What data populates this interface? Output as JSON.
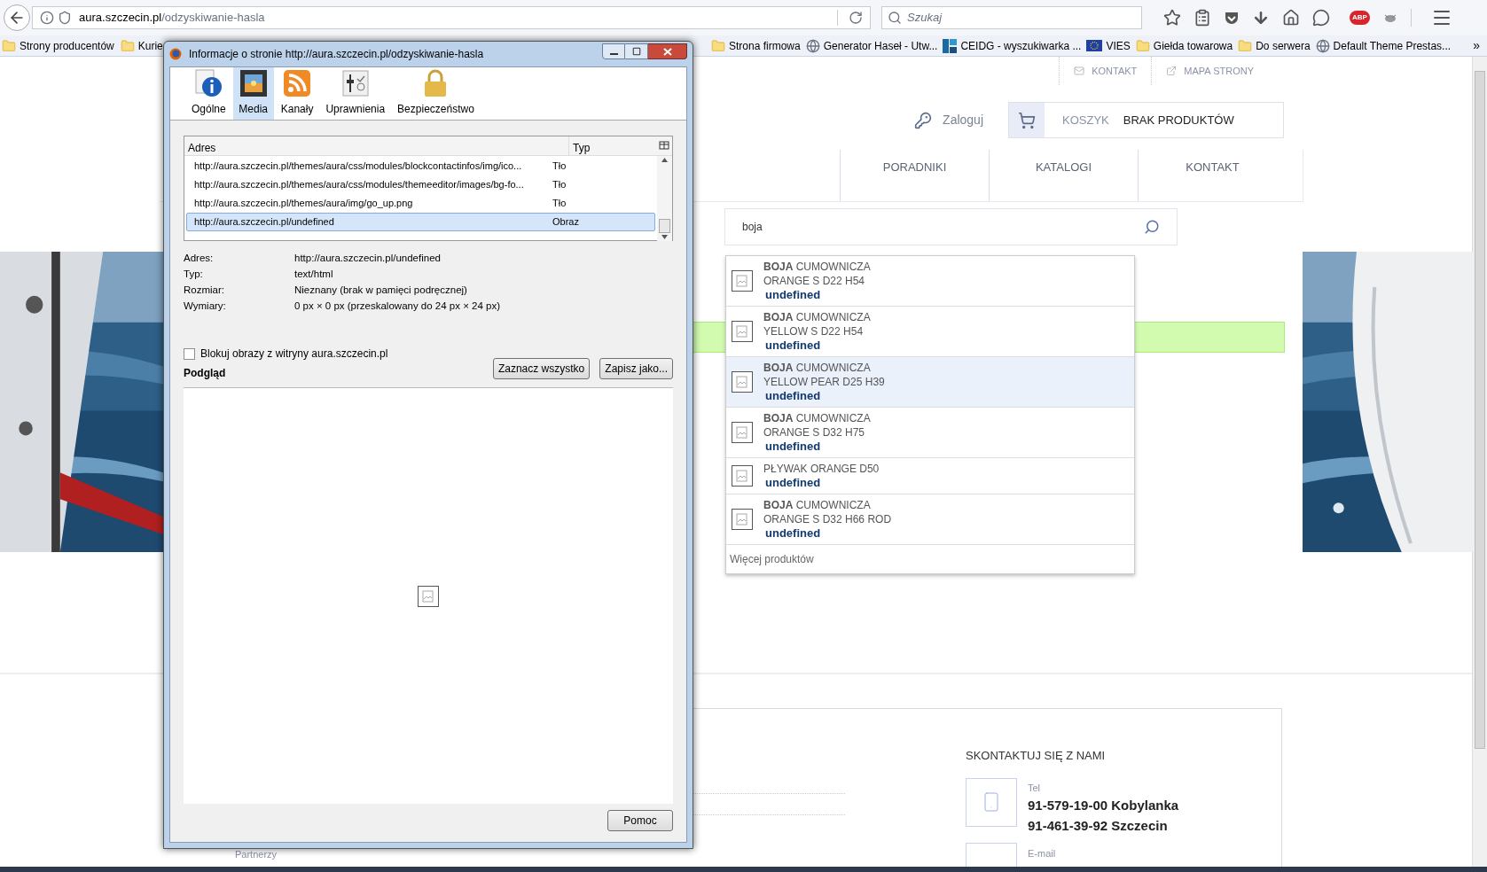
{
  "browser": {
    "url_host": "aura.szczecin.pl",
    "url_path": "/odzyskiwanie-hasla",
    "search_placeholder": "Szukaj",
    "addon_badge": "ABP",
    "bookmarks_left": [
      {
        "label": "Strony producentów",
        "kind": "folder"
      },
      {
        "label": "Kurie",
        "kind": "folder"
      }
    ],
    "bookmarks_right": [
      {
        "label": "Strona firmowa",
        "kind": "folder"
      },
      {
        "label": "Generator Haseł - Utw...",
        "kind": "globe"
      },
      {
        "label": "CEIDG - wyszukiwarka ...",
        "kind": "ceidg"
      },
      {
        "label": "VIES",
        "kind": "eu"
      },
      {
        "label": "Giełda towarowa",
        "kind": "folder"
      },
      {
        "label": "Do serwera",
        "kind": "folder"
      },
      {
        "label": "Default Theme Prestas...",
        "kind": "globe"
      }
    ],
    "overflow": "»"
  },
  "dialog": {
    "title": "Informacje o stronie http://aura.szczecin.pl/odzyskiwanie-hasla",
    "tabs": [
      {
        "label": "Ogólne",
        "kind": "info",
        "selected": false
      },
      {
        "label": "Media",
        "kind": "media",
        "selected": true
      },
      {
        "label": "Kanały",
        "kind": "feed",
        "selected": false
      },
      {
        "label": "Uprawnienia",
        "kind": "permissions",
        "selected": false
      },
      {
        "label": "Bezpieczeństwo",
        "kind": "lock",
        "selected": false
      }
    ],
    "columns": [
      "Adres",
      "Typ"
    ],
    "rows": [
      {
        "address": "http://aura.szczecin.pl/themes/aura/css/modules/blockcontactinfos/img/ico...",
        "type": "Tło",
        "selected": false
      },
      {
        "address": "http://aura.szczecin.pl/themes/aura/css/modules/themeeditor/images/bg-fo...",
        "type": "Tło",
        "selected": false
      },
      {
        "address": "http://aura.szczecin.pl/themes/aura/img/go_up.png",
        "type": "Tło",
        "selected": false
      },
      {
        "address": "http://aura.szczecin.pl/undefined",
        "type": "Obraz",
        "selected": true
      }
    ],
    "details": [
      {
        "label": "Adres:",
        "value": "http://aura.szczecin.pl/undefined"
      },
      {
        "label": "Typ:",
        "value": "text/html"
      },
      {
        "label": "Rozmiar:",
        "value": "Nieznany (brak w pamięci podręcznej)"
      },
      {
        "label": "Wymiary:",
        "value": "0 px × 0 px (przeskalowany do 24 px × 24 px)"
      }
    ],
    "block_images": {
      "label": "Blokuj obrazy z witryny aura.szczecin.pl",
      "checked": false
    },
    "preview_label": "Podgląd",
    "buttons": [
      "Zaznacz wszystko",
      "Zapisz jako..."
    ],
    "help_button": "Pomoc"
  },
  "page": {
    "top_links": [
      {
        "label": "KONTAKT",
        "kind": "mail"
      },
      {
        "label": "MAPA STRONY",
        "kind": "external"
      }
    ],
    "login": "Zaloguj",
    "cart": {
      "label": "KOSZYK",
      "value": "BRAK PRODUKTÓW"
    },
    "nav": [
      "PORADNIKI",
      "KATALOGI",
      "KONTAKT"
    ],
    "search": {
      "value": "boja"
    },
    "suggestions": [
      {
        "name": "**BOJA** CUMOWNICZA",
        "line2": "ORANGE S D22 H54",
        "price": "undefined",
        "selected": false
      },
      {
        "name": "**BOJA** CUMOWNICZA",
        "line2": "YELLOW S D22 H54",
        "price": "undefined",
        "selected": false
      },
      {
        "name": "**BOJA** CUMOWNICZA",
        "line2": "YELLOW PEAR D25 H39",
        "price": "undefined",
        "selected": true
      },
      {
        "name": "**BOJA** CUMOWNICZA",
        "line2": "ORANGE S D32 H75",
        "price": "undefined",
        "selected": false
      },
      {
        "name": "PŁYWAK ORANGE D50",
        "price": "undefined",
        "selected": false
      },
      {
        "name": "**BOJA** CUMOWNICZA",
        "line2": "ORANGE S D32 H66 ROD",
        "price": "undefined",
        "selected": false
      }
    ],
    "more": "Więcej produktów",
    "contact": {
      "title": "SKONTAKTUJ SIĘ Z NAMI",
      "tel_label": "Tel",
      "phones": [
        "91-579-19-00 Kobylanka",
        "91-461-39-92 Szczecin"
      ],
      "email_label": "E-mail"
    },
    "footer_link": "Partnerzy"
  }
}
